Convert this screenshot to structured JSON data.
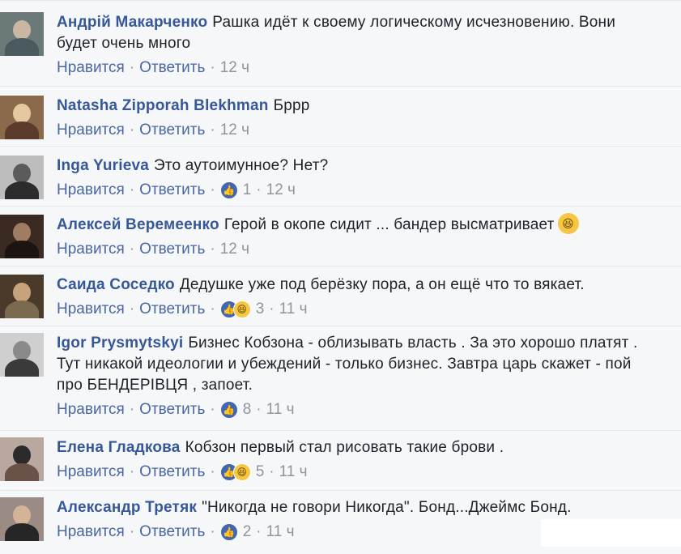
{
  "like_label": "Нравится",
  "reply_label": "Ответить",
  "comments": [
    {
      "author": "Андрій Макарченко",
      "text": "Рашка идёт к своему логическому исчезновению. Вони будет очень много",
      "time": "12 ч",
      "reactions": null
    },
    {
      "author": "Natasha Zipporah Blekhman",
      "text": "Бррр",
      "time": "12 ч",
      "reactions": null
    },
    {
      "author": "Inga Yurieva",
      "text": "Это аутоимунное? Нет?",
      "time": "12 ч",
      "reactions": "1"
    },
    {
      "author": "Алексей Веремеенко",
      "text": "Герой в окопе сидит ... бандер высматривает",
      "time": "12 ч",
      "reactions": null,
      "emoji": "laughing-emoji"
    },
    {
      "author": "Саида Соседко",
      "text": "Дедушке уже под берёзку пора, а он ещё что то вякает.",
      "time": "11 ч",
      "reactions": "3"
    },
    {
      "author": "Igor Prysmytskyi",
      "text": "Бизнес Кобзона - облизывать власть . За это хорошо платят . Тут никакой идеологии и убеждений - только бизнес. Завтра царь скажет - пой про БЕНДЕРІВЦЯ , запоет.",
      "time": "11 ч",
      "reactions": "8"
    },
    {
      "author": "Елена Гладкова",
      "text": "Кобзон первый стал рисовать такие брови .",
      "time": "11 ч",
      "reactions": "5"
    },
    {
      "author": "Александр Третяк",
      "text": "\"Никогда не говори Никогда\". Бонд...Джеймс Бонд.",
      "time": "11 ч",
      "reactions": "2"
    }
  ],
  "colors": {
    "author": "#365899",
    "link": "#4b67a1",
    "meta": "#90949c",
    "like": "#4267b2",
    "haha": "#f7c643"
  }
}
